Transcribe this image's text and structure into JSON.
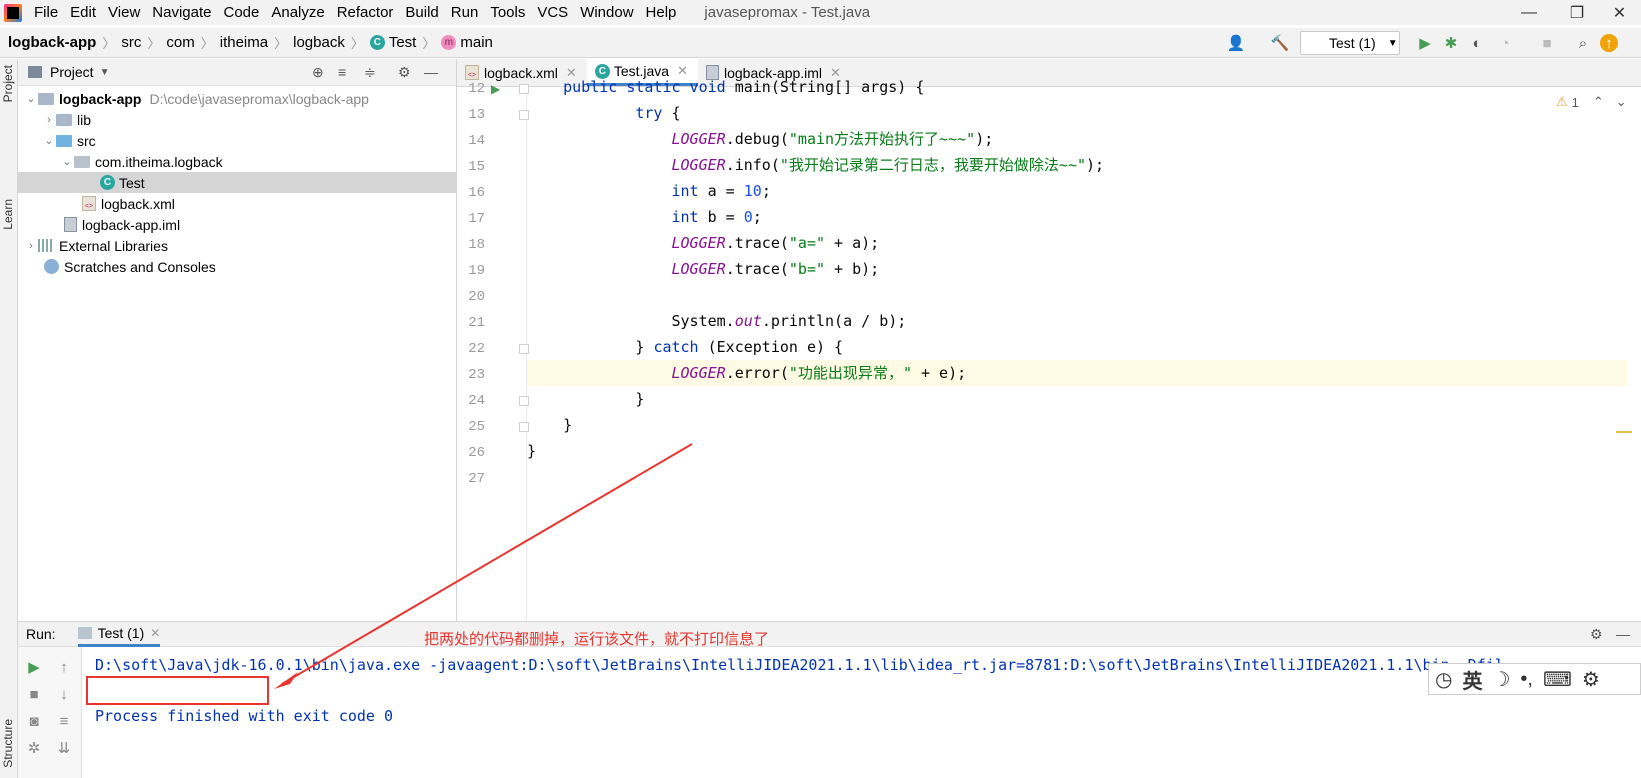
{
  "menubar": {
    "items": [
      "File",
      "Edit",
      "View",
      "Navigate",
      "Code",
      "Analyze",
      "Refactor",
      "Build",
      "Run",
      "Tools",
      "VCS",
      "Window",
      "Help"
    ],
    "window_title": "javasepromax - Test.java"
  },
  "breadcrumb": [
    "logback-app",
    "src",
    "com",
    "itheima",
    "logback",
    "Test",
    "main"
  ],
  "run_config": "Test (1)",
  "left_strip": {
    "project": "Project",
    "learn": "Learn",
    "structure": "Structure"
  },
  "project_panel": {
    "title": "Project",
    "tree": [
      {
        "label": "logback-app",
        "path": "D:\\code\\javasepromax\\logback-app"
      },
      {
        "label": "lib"
      },
      {
        "label": "src"
      },
      {
        "label": "com.itheima.logback"
      },
      {
        "label": "Test"
      },
      {
        "label": "logback.xml"
      },
      {
        "label": "logback-app.iml"
      },
      {
        "label": "External Libraries"
      },
      {
        "label": "Scratches and Consoles"
      }
    ]
  },
  "editor_tabs": [
    "logback.xml",
    "Test.java",
    "logback-app.iml"
  ],
  "editor": {
    "line_numbers": [
      "12",
      "13",
      "14",
      "15",
      "16",
      "17",
      "18",
      "19",
      "20",
      "21",
      "22",
      "23",
      "24",
      "25",
      "26",
      "27"
    ],
    "warning_count": "1",
    "lines": {
      "l12_a": "public static void ",
      "l12_b": "main(String[] args) {",
      "l13_kw": "try",
      "l13_b": " {",
      "l14_logger": "LOGGER",
      "l14_call": ".debug(",
      "l14_str": "\"main方法开始执行了~~~\"",
      "l14_end": ");",
      "l15_logger": "LOGGER",
      "l15_call": ".info(",
      "l15_str": "\"我开始记录第二行日志，我要开始做除法~~\"",
      "l15_end": ");",
      "l16_kw": "int",
      "l16_a": " a = ",
      "l16_num": "10",
      "l16_end": ";",
      "l17_kw": "int",
      "l17_a": " b = ",
      "l17_num": "0",
      "l17_end": ";",
      "l18_logger": "LOGGER",
      "l18_call": ".trace(",
      "l18_str": "\"a=\"",
      "l18_end": " + a);",
      "l19_logger": "LOGGER",
      "l19_call": ".trace(",
      "l19_str": "\"b=\"",
      "l19_end": " + b);",
      "l21_a": "System.",
      "l21_out": "out",
      "l21_b": ".println(a / b);",
      "l22_a": "} ",
      "l22_kw": "catch",
      "l22_b": " (Exception e) {",
      "l23_logger": "LOGGER",
      "l23_call": ".error(",
      "l23_str": "\"功能出现异常，\"",
      "l23_end": " + e);",
      "l24": "}",
      "l25": "}",
      "l26": "}"
    }
  },
  "run_panel": {
    "label": "Run:",
    "tab": "Test (1)",
    "console": [
      "D:\\soft\\Java\\jdk-16.0.1\\bin\\java.exe -javaagent:D:\\soft\\JetBrains\\IntelliJIDEA2021.1.1\\lib\\idea_rt.jar=8781:D:\\soft\\JetBrains\\IntelliJIDEA2021.1.1\\bin -Dfil",
      "",
      "Process finished with exit code 0"
    ]
  },
  "annotation_text": "把两处的代码都删掉，运行该文件，就不打印信息了",
  "ime": {
    "lang": "英"
  },
  "colors": {
    "annotation": "#e8352d",
    "keyword": "#0033b3",
    "string": "#067d17",
    "field": "#871094",
    "number": "#1750eb"
  }
}
